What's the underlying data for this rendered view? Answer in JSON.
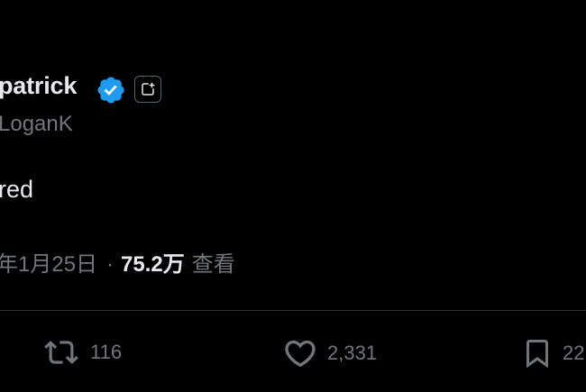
{
  "author": {
    "name": "patrick",
    "handle": "LoganK",
    "verified_icon": "verified-badge-icon",
    "verified_color": "#1d9bf0",
    "subscribe_icon": "subscribe-icon"
  },
  "tweet": {
    "text": "red",
    "date": "年1月25日",
    "separator": "·",
    "views": "75.2万",
    "views_label": "查看"
  },
  "actions": {
    "retweet": {
      "icon": "retweet-icon",
      "count": "116"
    },
    "like": {
      "icon": "heart-icon",
      "count": "2,331"
    },
    "bookmark": {
      "icon": "bookmark-icon",
      "count": "22"
    }
  },
  "colors": {
    "background": "#000000",
    "primary_text": "#e7e9ea",
    "secondary_text": "#71767b",
    "divider": "#2f3336"
  }
}
